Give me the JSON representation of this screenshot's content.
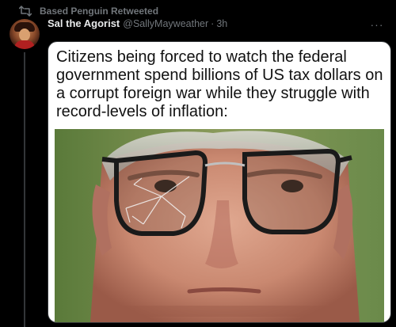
{
  "retweet": {
    "icon": "retweet-icon",
    "label": "Based Penguin Retweeted"
  },
  "tweet": {
    "author_name": "Sal the Agorist",
    "handle": "@SallyMayweather",
    "separator": "·",
    "time": "3h",
    "more_icon": "more-icon",
    "more_label": "···"
  },
  "media": {
    "caption": "Citizens being forced to watch the federal government spend billions of US tax dollars on a corrupt foreign war while they struggle with record-levels of inflation:",
    "photo_icon": "photo-man-cracked-glasses"
  },
  "colors": {
    "background": "#000000",
    "text_primary": "#e7e9ea",
    "text_secondary": "#71767b",
    "border": "#333639"
  }
}
